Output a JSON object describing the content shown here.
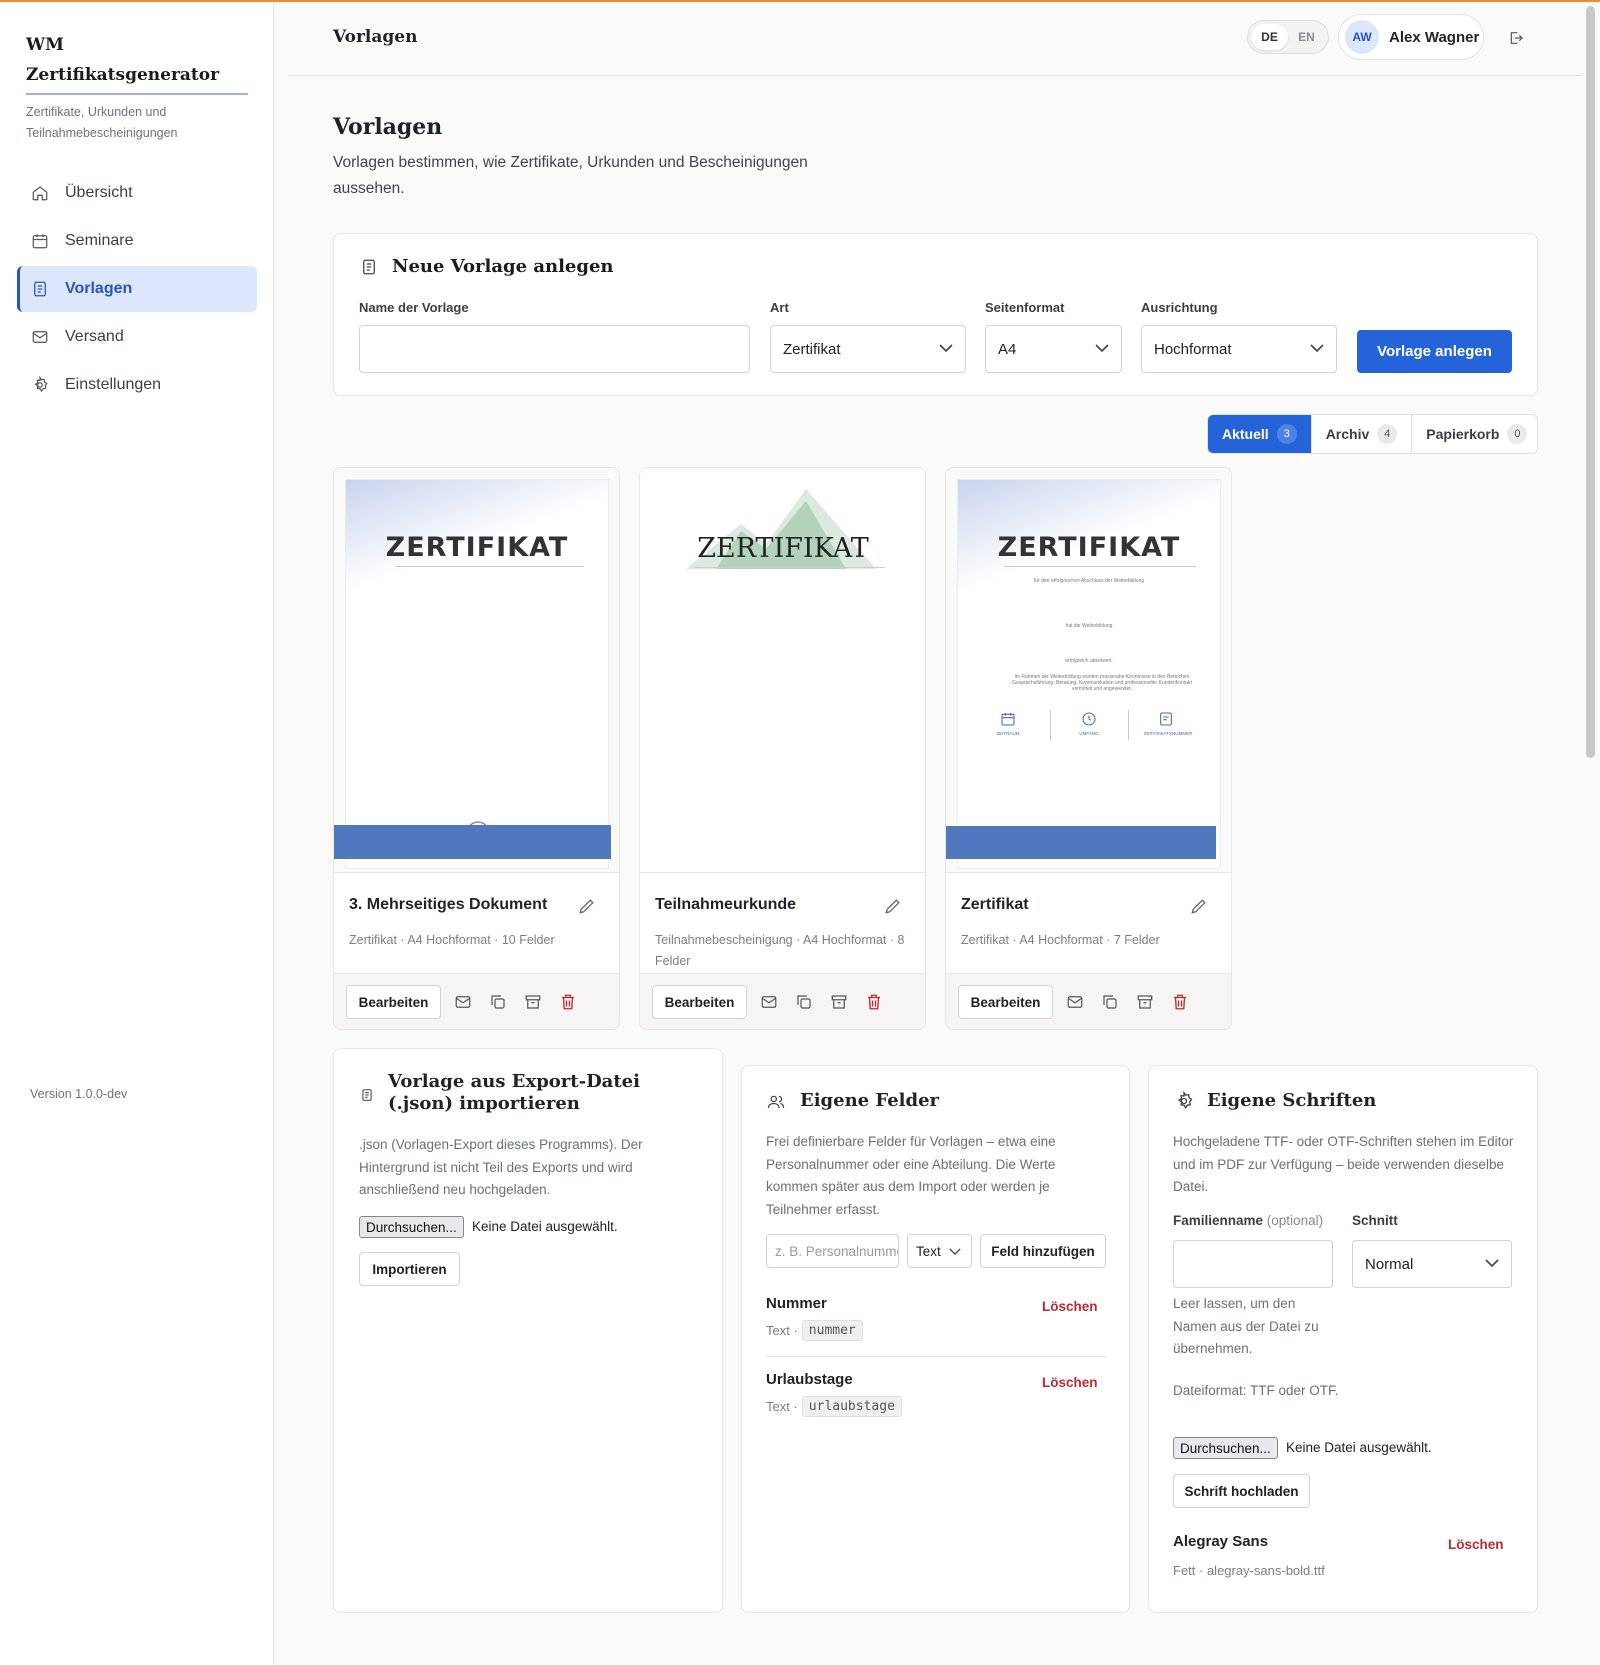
{
  "app": {
    "brand": "WM Zertifikatsgenerator",
    "brand_line1": "WM",
    "brand_line2": "Zertifikatsgenerator",
    "tagline": "Zertifikate, Urkunden und Teilnahmebescheinigungen",
    "version": "Version 1.0.0-dev"
  },
  "sidebar": {
    "items": [
      {
        "label": "Übersicht",
        "icon": "home-icon"
      },
      {
        "label": "Seminare",
        "icon": "calendar-icon"
      },
      {
        "label": "Vorlagen",
        "icon": "document-icon",
        "active": true
      },
      {
        "label": "Versand",
        "icon": "mail-icon"
      },
      {
        "label": "Einstellungen",
        "icon": "gear-icon"
      }
    ]
  },
  "header": {
    "title": "Vorlagen",
    "lang": {
      "de": "DE",
      "en": "EN",
      "active": "DE"
    },
    "user": {
      "initials": "AW",
      "name": "Alex Wagner"
    }
  },
  "page": {
    "title": "Vorlagen",
    "description": "Vorlagen bestimmen, wie Zertifikate, Urkunden und Bescheinigungen aussehen."
  },
  "new_template": {
    "title": "Neue Vorlage anlegen",
    "name_label": "Name der Vorlage",
    "name_value": "",
    "type_label": "Art",
    "type_value": "Zertifikat",
    "format_label": "Seitenformat",
    "format_value": "A4",
    "orientation_label": "Ausrichtung",
    "orientation_value": "Hochformat",
    "submit": "Vorlage anlegen"
  },
  "tabs": [
    {
      "label": "Aktuell",
      "count": "3",
      "active": true
    },
    {
      "label": "Archiv",
      "count": "4"
    },
    {
      "label": "Papierkorb",
      "count": "0"
    }
  ],
  "templates": [
    {
      "name": "3. Mehrseitiges Dokument",
      "meta": "Zertifikat · A4 Hochformat · 10 Felder",
      "thumb_title": "ZERTIFIKAT",
      "edit": "Bearbeiten"
    },
    {
      "name": "Teilnahmeurkunde",
      "meta": "Teilnahmebescheinigung · A4 Hochformat · 8 Felder",
      "thumb_title": "ZERTIFIKAT",
      "edit": "Bearbeiten"
    },
    {
      "name": "Zertifikat",
      "meta": "Zertifikat · A4 Hochformat · 7 Felder",
      "thumb_title": "ZERTIFIKAT",
      "edit": "Bearbeiten"
    }
  ],
  "thumb3": {
    "line1": "für den erfolgreichen Abschluss der Weiterbildung",
    "line2": "hat die Weiterbildung",
    "line3": "erfolgreich absolviert.",
    "line4": "Im Rahmen der Weiterbildung wurden praxisnahe Kenntnisse in den Bereichen Gesprächsführung, Beratung, Kommunikation und professioneller Kundenkontakt vermittelt und angewendet.",
    "col1": "ZEITRAUM",
    "col2": "UMFANG",
    "col3": "ZERTIFIKATSNUMMER"
  },
  "import": {
    "title": "Vorlage aus Export-Datei (.json) importieren",
    "text": ".json (Vorlagen-Export dieses Programms). Der Hintergrund ist nicht Teil des Exports und wird anschließend neu hochgeladen.",
    "browse": "Durchsuchen...",
    "no_file": "Keine Datei ausgewählt.",
    "submit": "Importieren"
  },
  "fields": {
    "title": "Eigene Felder",
    "text": "Frei definierbare Felder für Vorlagen – etwa eine Personalnummer oder eine Abteilung. Die Werte kommen später aus dem Import oder werden je Teilnehmer erfasst.",
    "placeholder": "z. B. Personalnummer",
    "type_value": "Text",
    "add": "Feld hinzufügen",
    "items": [
      {
        "name": "Nummer",
        "type": "Text ·",
        "key": "nummer",
        "delete": "Löschen"
      },
      {
        "name": "Urlaubstage",
        "type": "Text ·",
        "key": "urlaubstage",
        "delete": "Löschen"
      }
    ]
  },
  "fonts": {
    "title": "Eigene Schriften",
    "text": "Hochgeladene TTF- oder OTF-Schriften stehen im Editor und im PDF zur Verfügung – beide verwenden dieselbe Datei.",
    "family_label": "Familienname",
    "family_optional": "(optional)",
    "style_label": "Schnitt",
    "style_value": "Normal",
    "hint": "Leer lassen, um den Namen aus der Datei zu übernehmen.",
    "format_hint": "Dateiformat: TTF oder OTF.",
    "browse": "Durchsuchen...",
    "no_file": "Keine Datei ausgewählt.",
    "upload": "Schrift hochladen",
    "items": [
      {
        "name": "Alegray Sans",
        "meta": "Fett · alegray-sans-bold.ttf",
        "delete": "Löschen"
      }
    ]
  },
  "colors": {
    "accent": "#2563d9",
    "danger": "#c0282d",
    "active_nav_bg": "#dde7fb",
    "top_border": "#f08a3c"
  }
}
